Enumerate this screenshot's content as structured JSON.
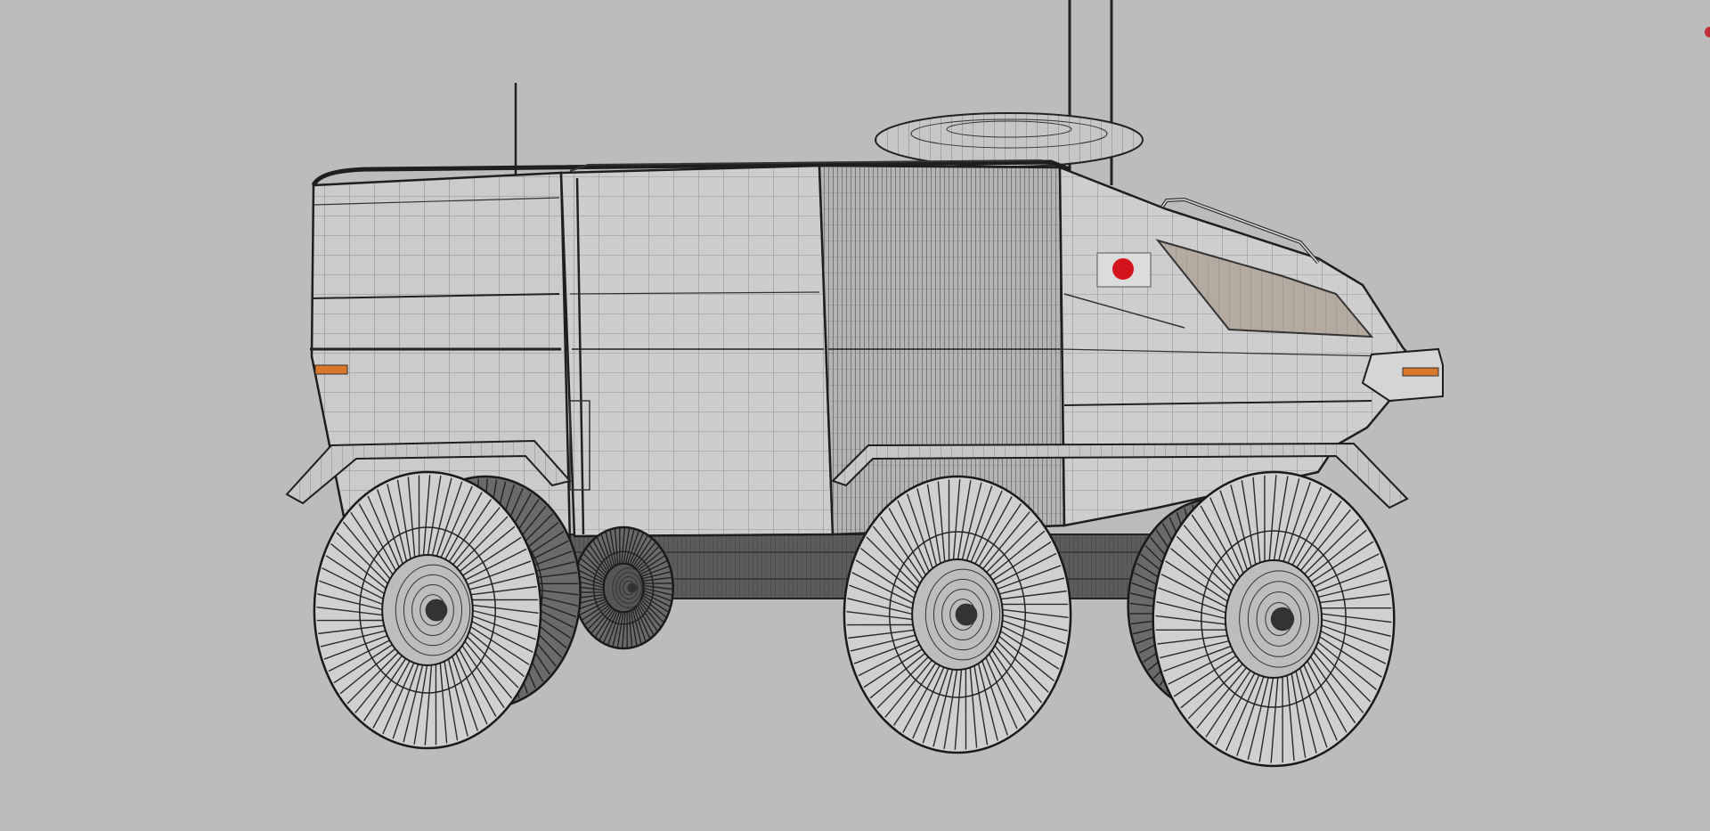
{
  "viewport": {
    "background": "#bcbcbc",
    "wire_color": "#2a2a2a",
    "body_fill": "#c9c9c9",
    "window_fill": "#b5aa9f",
    "lamp_color": "#d9772b",
    "flag_red": "#d4141c",
    "flag_white": "#dcdcdc",
    "marker_color": "#c0303a"
  },
  "model": {
    "name_icon": "rover-wireframe-icon",
    "wheel_count": 6
  }
}
